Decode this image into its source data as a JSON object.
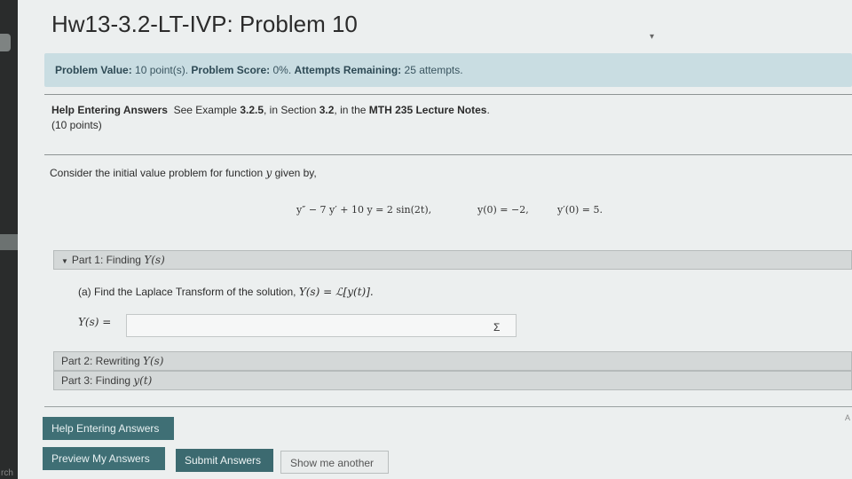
{
  "header": {
    "title": "Hw13-3.2-LT-IVP: Problem 10"
  },
  "info": {
    "value_label": "Problem Value:",
    "value_text": "10 point(s).",
    "score_label": "Problem Score:",
    "score_text": "0%.",
    "attempts_label": "Attempts Remaining:",
    "attempts_text": "25 attempts."
  },
  "help": {
    "label": "Help Entering Answers",
    "text_pre": "See Example ",
    "example": "3.2.5",
    "text_mid": ", in Section ",
    "section": "3.2",
    "text_in": ", in the ",
    "notes": "MTH 235 Lecture Notes",
    "text_end": ".",
    "points": "(10 points)"
  },
  "problem": {
    "consider_text": "Consider the initial value problem for function",
    "consider_var": "y",
    "consider_end": "given by,",
    "equation": "y″ − 7 y′ + 10 y = 2 sin(2t),",
    "ic1": "y(0) = −2,",
    "ic2": "y′(0) = 5."
  },
  "parts": [
    {
      "label": "Part 1: Finding",
      "math": "Y(s)"
    },
    {
      "label": "Part 2: Rewriting",
      "math": "Y(s)"
    },
    {
      "label": "Part 3: Finding",
      "math": "y(t)"
    }
  ],
  "part1": {
    "question": "(a) Find the Laplace Transform of the solution,",
    "question_math": "Y(s) = ℒ[y(t)].",
    "answer_label": "Y(s) =",
    "answer_value": "",
    "sigma": "Σ"
  },
  "buttons": {
    "help": "Help Entering Answers",
    "preview": "Preview My Answers",
    "submit": "Submit Answers",
    "another": "Show me another"
  },
  "side": {
    "left_text": "rch",
    "right_text": "A"
  }
}
